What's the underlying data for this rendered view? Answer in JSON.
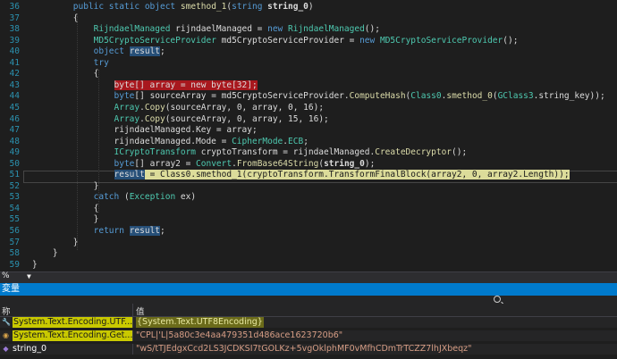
{
  "editor": {
    "lines": [
      {
        "n": "36",
        "indent": 0,
        "segments": [
          {
            "t": "        "
          },
          {
            "t": "public static object ",
            "c": "kw"
          },
          {
            "t": "smethod_1",
            "c": "fn"
          },
          {
            "t": "(",
            "c": "pl"
          },
          {
            "t": "string ",
            "c": "kw"
          },
          {
            "t": "string_0",
            "c": "pl bold"
          },
          {
            "t": ")",
            "c": "pl"
          }
        ]
      },
      {
        "n": "37",
        "segments": [
          {
            "t": "        {"
          }
        ]
      },
      {
        "n": "38",
        "segments": [
          {
            "t": "            "
          },
          {
            "t": "RijndaelManaged",
            "c": "ty"
          },
          {
            "t": " rijndaelManaged = "
          },
          {
            "t": "new ",
            "c": "kw"
          },
          {
            "t": "RijndaelManaged",
            "c": "ty"
          },
          {
            "t": "();"
          }
        ]
      },
      {
        "n": "39",
        "segments": [
          {
            "t": "            "
          },
          {
            "t": "MD5CryptoServiceProvider",
            "c": "ty"
          },
          {
            "t": " md5CryptoServiceProvider = "
          },
          {
            "t": "new ",
            "c": "kw"
          },
          {
            "t": "MD5CryptoServiceProvider",
            "c": "ty"
          },
          {
            "t": "();"
          }
        ]
      },
      {
        "n": "40",
        "segments": [
          {
            "t": "            "
          },
          {
            "t": "object ",
            "c": "kw"
          },
          {
            "t": "result",
            "c": "pl",
            "hl": "blue"
          },
          {
            "t": ";"
          }
        ]
      },
      {
        "n": "41",
        "segments": [
          {
            "t": "            "
          },
          {
            "t": "try",
            "c": "kw"
          }
        ]
      },
      {
        "n": "42",
        "segments": [
          {
            "t": "            {"
          }
        ]
      },
      {
        "n": "43",
        "segments": [
          {
            "t": "                "
          },
          {
            "t": "byte[] array = new byte[32];",
            "c": "pl",
            "hl": "red"
          }
        ]
      },
      {
        "n": "44",
        "segments": [
          {
            "t": "                "
          },
          {
            "t": "byte",
            "c": "kw"
          },
          {
            "t": "[] sourceArray = md5CryptoServiceProvider."
          },
          {
            "t": "ComputeHash",
            "c": "fn"
          },
          {
            "t": "("
          },
          {
            "t": "Class0",
            "c": "ty"
          },
          {
            "t": "."
          },
          {
            "t": "smethod_0",
            "c": "fn"
          },
          {
            "t": "("
          },
          {
            "t": "GClass3",
            "c": "ty"
          },
          {
            "t": ".string_key));"
          }
        ]
      },
      {
        "n": "45",
        "segments": [
          {
            "t": "                "
          },
          {
            "t": "Array",
            "c": "ty"
          },
          {
            "t": "."
          },
          {
            "t": "Copy",
            "c": "fn"
          },
          {
            "t": "(sourceArray, 0, array, 0, 16);"
          }
        ]
      },
      {
        "n": "46",
        "segments": [
          {
            "t": "                "
          },
          {
            "t": "Array",
            "c": "ty"
          },
          {
            "t": "."
          },
          {
            "t": "Copy",
            "c": "fn"
          },
          {
            "t": "(sourceArray, 0, array, 15, 16);"
          }
        ]
      },
      {
        "n": "47",
        "segments": [
          {
            "t": "                "
          },
          {
            "t": "rijndaelManaged.Key = array;"
          }
        ]
      },
      {
        "n": "48",
        "segments": [
          {
            "t": "                "
          },
          {
            "t": "rijndaelManaged.Mode = "
          },
          {
            "t": "CipherMode",
            "c": "ty"
          },
          {
            "t": "."
          },
          {
            "t": "ECB",
            "c": "ty"
          },
          {
            "t": ";"
          }
        ]
      },
      {
        "n": "49",
        "segments": [
          {
            "t": "                "
          },
          {
            "t": "ICryptoTransform",
            "c": "ty"
          },
          {
            "t": " cryptoTransform = rijndaelManaged."
          },
          {
            "t": "CreateDecryptor",
            "c": "fn"
          },
          {
            "t": "();"
          }
        ]
      },
      {
        "n": "50",
        "segments": [
          {
            "t": "                "
          },
          {
            "t": "byte",
            "c": "kw"
          },
          {
            "t": "[] array2 = "
          },
          {
            "t": "Convert",
            "c": "ty"
          },
          {
            "t": "."
          },
          {
            "t": "FromBase64String",
            "c": "fn"
          },
          {
            "t": "("
          },
          {
            "t": "string_0",
            "c": "pl bold"
          },
          {
            "t": ");"
          }
        ]
      },
      {
        "n": "51",
        "segments": [
          {
            "t": "                "
          },
          {
            "t": "result",
            "c": "pl",
            "hl": "blue"
          },
          {
            "t": " = Class0.smethod_1(cryptoTransform.TransformFinalBlock(array2, 0, array2.Length));",
            "c": "pl",
            "hl": "yellow"
          }
        ]
      },
      {
        "n": "52",
        "segments": [
          {
            "t": "            }"
          }
        ]
      },
      {
        "n": "53",
        "segments": [
          {
            "t": "            "
          },
          {
            "t": "catch ",
            "c": "kw"
          },
          {
            "t": "("
          },
          {
            "t": "Exception",
            "c": "ty"
          },
          {
            "t": " ex)"
          }
        ]
      },
      {
        "n": "54",
        "segments": [
          {
            "t": "            {"
          }
        ]
      },
      {
        "n": "55",
        "segments": [
          {
            "t": "            }"
          }
        ]
      },
      {
        "n": "56",
        "segments": [
          {
            "t": "            "
          },
          {
            "t": "return ",
            "c": "kw"
          },
          {
            "t": "result",
            "c": "pl",
            "hl": "blue"
          },
          {
            "t": ";"
          }
        ]
      },
      {
        "n": "57",
        "segments": [
          {
            "t": "        }"
          }
        ]
      },
      {
        "n": "58",
        "segments": [
          {
            "t": "    }"
          }
        ]
      },
      {
        "n": "59",
        "segments": [
          {
            "t": "}"
          }
        ]
      },
      {
        "n": "60",
        "segments": [
          {
            "t": ""
          }
        ]
      }
    ]
  },
  "status": {
    "zoom": "%",
    "zoom_arrow": "▼"
  },
  "locals_panel": {
    "title": "変量",
    "col_name": "称",
    "col_value": "值",
    "rows": [
      {
        "icon": "wrench-icon",
        "icon_glyph": "🔧",
        "name": "System.Text.Encoding.UTF...",
        "name_style": "sel",
        "value": "{System.Text.UTF8Encoding}",
        "value_style": "yellow"
      },
      {
        "icon": "return-value-icon",
        "icon_glyph": "◉",
        "name": "System.Text.Encoding.Get...",
        "name_style": "sel",
        "value": "\"CPL|'L|5a80c3e4aa479351d486ace1623720b6\"",
        "value_style": "str"
      },
      {
        "icon": "field-icon",
        "icon_glyph": "◆",
        "name": "string_0",
        "name_style": "plain",
        "value": "\"wS/tTJEdgxCcd2LS3JCDKSI7tGOLKz+5vgOklphMF0vMfhCDmTrTCZZ7lhJXbeqz\"",
        "value_style": "str"
      }
    ]
  }
}
